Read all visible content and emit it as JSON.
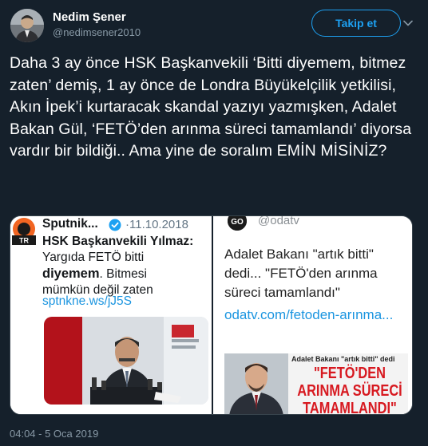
{
  "author": {
    "name": "Nedim Şener",
    "handle": "@nedimsener2010",
    "avatar_icon": "user-avatar"
  },
  "header": {
    "follow_label": "Takip et",
    "menu_icon": "chevron-down-icon"
  },
  "tweet": {
    "text": "Daha 3 ay önce HSK Başkanvekili ‘Bitti diyemem, bitmez zaten’ demiş, 1 ay önce de Londra Büyükelçilik yetkilisi, Akın İpek’i kurtaracak skandal yazıyı yazmışken, Adalet Bakan Gül, ‘FETÖ’den arınma süreci tamamlandı’ diyorsa vardır bir bildiği.. Ama yine de soralım EMİN MİSİNİZ?",
    "timestamp": "04:04 - 5 Oca 2019"
  },
  "media": {
    "left": {
      "logo_text": "SPUTNIK",
      "logo_badge": "TR",
      "account_name": "Sputnik...",
      "verified_icon": "verified-badge-icon",
      "date": "·11.10.2018",
      "headline_bold": "HSK Başkanvekili Yılmaz:",
      "headline_line2": "Yargıda FETÖ bitti",
      "headline_emph": "diyemem",
      "headline_line3_rest": ". Bitmesi",
      "headline_line4": "mümkün değil zaten",
      "link": "sptnkne.ws/jJ5S"
    },
    "right": {
      "logo_text": "GO",
      "handle": "@odatv",
      "text": "Adalet Bakanı \"artık bitti\" dedi... \"FETÖ'den arınma süreci tamamlandı\"",
      "link": "odatv.com/fetoden-arınma...",
      "photo_caption": "Adalet Bakanı \"artık bitti\" dedi",
      "photo_headline": "\"FETÖ'DEN ARINMA SÜRECİ TAMAMLANDI\""
    }
  },
  "colors": {
    "background": "#15202b",
    "accent": "#1da1f2",
    "muted": "#8899a6",
    "link": "#1b95e0",
    "headline_red": "#d71920"
  }
}
